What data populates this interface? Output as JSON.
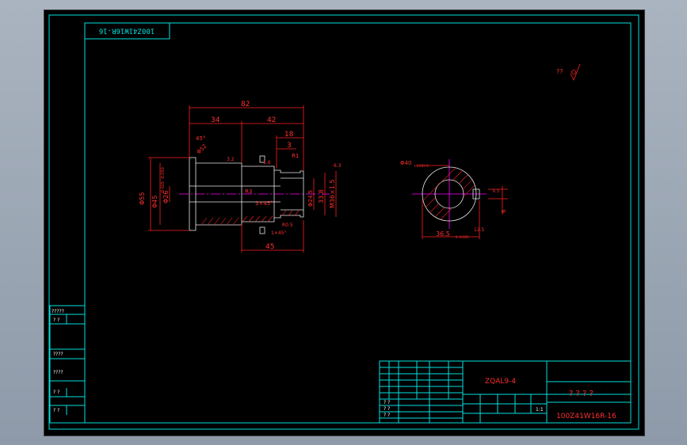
{
  "drawing": {
    "stamp_text": "100Z41W16R-16",
    "roughness_symbol": "??",
    "title_block": {
      "material": "ZQAL9-4",
      "part_name": "? ? ? ?",
      "drawing_number": "100Z41W16R-16",
      "scale": "1:1",
      "qmarks": [
        "? ?",
        "? ?",
        "? ?"
      ]
    },
    "side_table": {
      "rows": [
        "?????",
        "?  ?",
        "????",
        "????",
        "?  ?",
        "?  ?"
      ]
    },
    "dimensions": {
      "overall_length": "82",
      "len_34": "34",
      "len_42": "42",
      "len_18": "18",
      "len_3": "3",
      "len_45": "45",
      "dia_55": "Φ55",
      "dia_45": "Φ45",
      "dia_45_tol": "-0.025 -0.050",
      "dia_26": "Φ26",
      "dia_33_8": "33.8",
      "thread": "M36×1.5",
      "chamfer_top": "45°",
      "chamfer_text": "3×45°",
      "r3": "R3",
      "r1": "R1",
      "r0_5": "R0.5",
      "groove_note": "1×45°",
      "undercut": "Φ24.5",
      "flange_chamfer": "Φ52",
      "right_dia": "Φ40",
      "right_dia_tol": "+0.035 0",
      "right_36_5": "36.5",
      "right_36_5_tol": "0 -0.025",
      "key_6": "6",
      "key_6_dev": "6.3",
      "rough_3_2": "3.2",
      "rough_6_3": "6.3",
      "rough_12_5": "12.5",
      "rough_1_6": "1.6"
    }
  }
}
